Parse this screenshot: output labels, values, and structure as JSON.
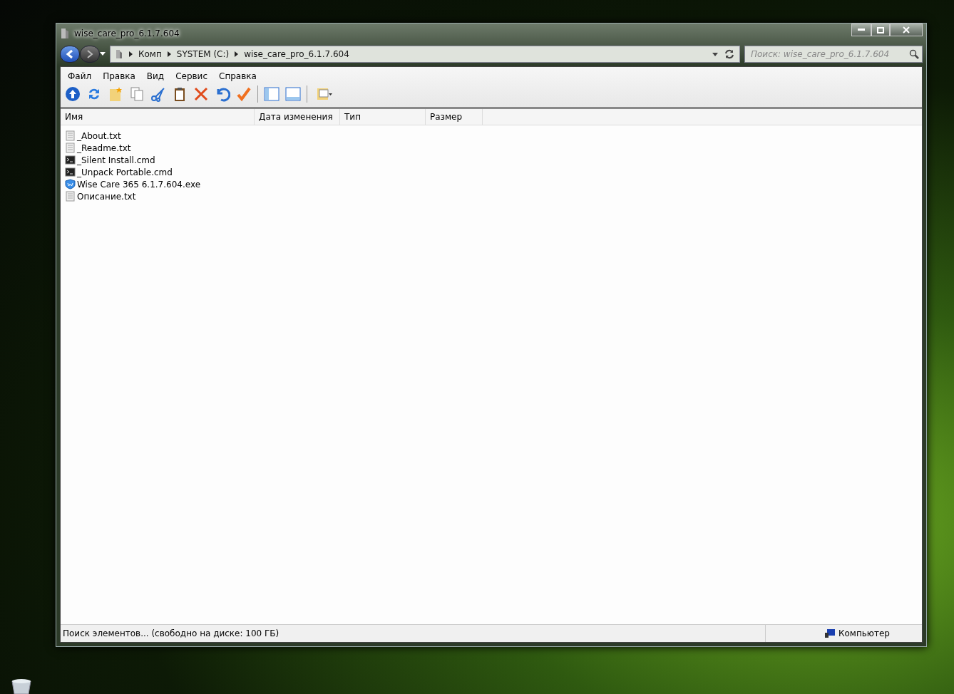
{
  "window": {
    "title": "wise_care_pro_6.1.7.604"
  },
  "address": {
    "crumbs": [
      "Комп",
      "SYSTEM (C:)",
      "wise_care_pro_6.1.7.604"
    ]
  },
  "search": {
    "placeholder": "Поиск: wise_care_pro_6.1.7.604"
  },
  "menu": [
    "Файл",
    "Правка",
    "Вид",
    "Сервис",
    "Справка"
  ],
  "table": {
    "columns": [
      "Имя",
      "Дата изменения",
      "Тип",
      "Размер"
    ],
    "rows": [
      {
        "name": "_About.txt",
        "kind": "text"
      },
      {
        "name": "_Readme.txt",
        "kind": "text"
      },
      {
        "name": "_Silent Install.cmd",
        "kind": "cmd"
      },
      {
        "name": "_Unpack Portable.cmd",
        "kind": "cmd"
      },
      {
        "name": "Wise Care 365 6.1.7.604.exe",
        "kind": "exe"
      },
      {
        "name": "Описание.txt",
        "kind": "text"
      }
    ]
  },
  "status_bar": {
    "message": "Поиск элементов... (свободно на диске: 100 ГБ)",
    "zone": "Компьютер"
  }
}
